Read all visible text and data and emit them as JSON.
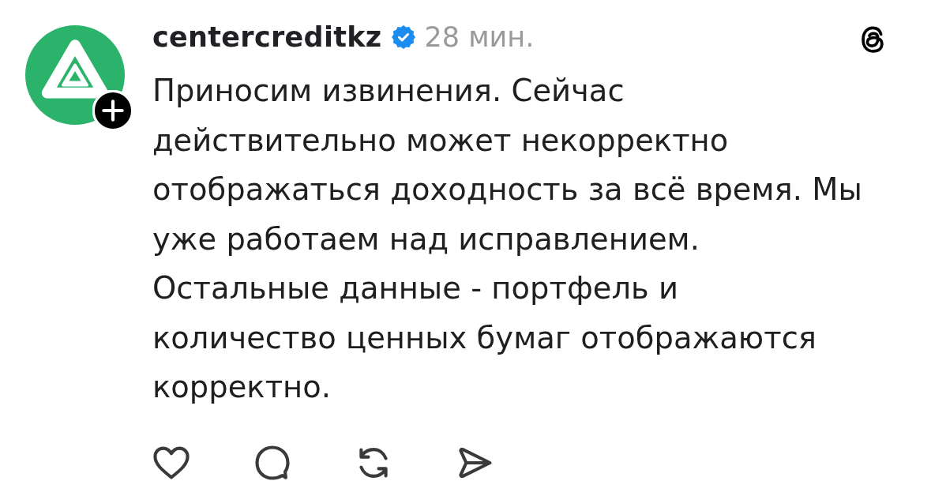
{
  "post": {
    "author": {
      "username": "centercreditkz",
      "verified": true
    },
    "time": "28 мин.",
    "body_lines": [
      "Приносим извинения. Сейчас",
      "действительно может некорректно",
      "отображаться доходность за всё время. Мы",
      "уже работаем над исправлением.",
      "Остальные данные - портфель и",
      "количество ценных бумаг отображаются",
      "корректно."
    ]
  }
}
